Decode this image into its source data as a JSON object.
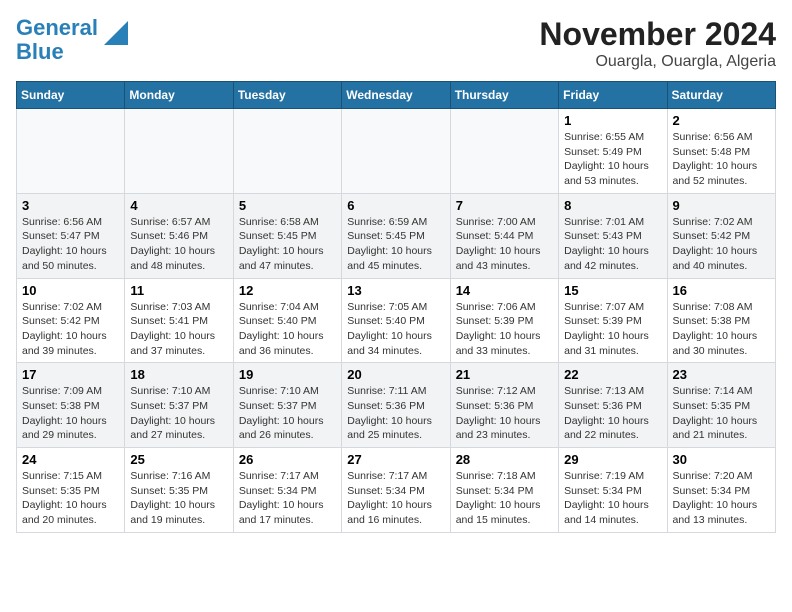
{
  "logo": {
    "line1": "General",
    "line2": "Blue"
  },
  "title": "November 2024",
  "subtitle": "Ouargla, Ouargla, Algeria",
  "weekdays": [
    "Sunday",
    "Monday",
    "Tuesday",
    "Wednesday",
    "Thursday",
    "Friday",
    "Saturday"
  ],
  "weeks": [
    [
      {
        "day": "",
        "detail": ""
      },
      {
        "day": "",
        "detail": ""
      },
      {
        "day": "",
        "detail": ""
      },
      {
        "day": "",
        "detail": ""
      },
      {
        "day": "",
        "detail": ""
      },
      {
        "day": "1",
        "detail": "Sunrise: 6:55 AM\nSunset: 5:49 PM\nDaylight: 10 hours\nand 53 minutes."
      },
      {
        "day": "2",
        "detail": "Sunrise: 6:56 AM\nSunset: 5:48 PM\nDaylight: 10 hours\nand 52 minutes."
      }
    ],
    [
      {
        "day": "3",
        "detail": "Sunrise: 6:56 AM\nSunset: 5:47 PM\nDaylight: 10 hours\nand 50 minutes."
      },
      {
        "day": "4",
        "detail": "Sunrise: 6:57 AM\nSunset: 5:46 PM\nDaylight: 10 hours\nand 48 minutes."
      },
      {
        "day": "5",
        "detail": "Sunrise: 6:58 AM\nSunset: 5:45 PM\nDaylight: 10 hours\nand 47 minutes."
      },
      {
        "day": "6",
        "detail": "Sunrise: 6:59 AM\nSunset: 5:45 PM\nDaylight: 10 hours\nand 45 minutes."
      },
      {
        "day": "7",
        "detail": "Sunrise: 7:00 AM\nSunset: 5:44 PM\nDaylight: 10 hours\nand 43 minutes."
      },
      {
        "day": "8",
        "detail": "Sunrise: 7:01 AM\nSunset: 5:43 PM\nDaylight: 10 hours\nand 42 minutes."
      },
      {
        "day": "9",
        "detail": "Sunrise: 7:02 AM\nSunset: 5:42 PM\nDaylight: 10 hours\nand 40 minutes."
      }
    ],
    [
      {
        "day": "10",
        "detail": "Sunrise: 7:02 AM\nSunset: 5:42 PM\nDaylight: 10 hours\nand 39 minutes."
      },
      {
        "day": "11",
        "detail": "Sunrise: 7:03 AM\nSunset: 5:41 PM\nDaylight: 10 hours\nand 37 minutes."
      },
      {
        "day": "12",
        "detail": "Sunrise: 7:04 AM\nSunset: 5:40 PM\nDaylight: 10 hours\nand 36 minutes."
      },
      {
        "day": "13",
        "detail": "Sunrise: 7:05 AM\nSunset: 5:40 PM\nDaylight: 10 hours\nand 34 minutes."
      },
      {
        "day": "14",
        "detail": "Sunrise: 7:06 AM\nSunset: 5:39 PM\nDaylight: 10 hours\nand 33 minutes."
      },
      {
        "day": "15",
        "detail": "Sunrise: 7:07 AM\nSunset: 5:39 PM\nDaylight: 10 hours\nand 31 minutes."
      },
      {
        "day": "16",
        "detail": "Sunrise: 7:08 AM\nSunset: 5:38 PM\nDaylight: 10 hours\nand 30 minutes."
      }
    ],
    [
      {
        "day": "17",
        "detail": "Sunrise: 7:09 AM\nSunset: 5:38 PM\nDaylight: 10 hours\nand 29 minutes."
      },
      {
        "day": "18",
        "detail": "Sunrise: 7:10 AM\nSunset: 5:37 PM\nDaylight: 10 hours\nand 27 minutes."
      },
      {
        "day": "19",
        "detail": "Sunrise: 7:10 AM\nSunset: 5:37 PM\nDaylight: 10 hours\nand 26 minutes."
      },
      {
        "day": "20",
        "detail": "Sunrise: 7:11 AM\nSunset: 5:36 PM\nDaylight: 10 hours\nand 25 minutes."
      },
      {
        "day": "21",
        "detail": "Sunrise: 7:12 AM\nSunset: 5:36 PM\nDaylight: 10 hours\nand 23 minutes."
      },
      {
        "day": "22",
        "detail": "Sunrise: 7:13 AM\nSunset: 5:36 PM\nDaylight: 10 hours\nand 22 minutes."
      },
      {
        "day": "23",
        "detail": "Sunrise: 7:14 AM\nSunset: 5:35 PM\nDaylight: 10 hours\nand 21 minutes."
      }
    ],
    [
      {
        "day": "24",
        "detail": "Sunrise: 7:15 AM\nSunset: 5:35 PM\nDaylight: 10 hours\nand 20 minutes."
      },
      {
        "day": "25",
        "detail": "Sunrise: 7:16 AM\nSunset: 5:35 PM\nDaylight: 10 hours\nand 19 minutes."
      },
      {
        "day": "26",
        "detail": "Sunrise: 7:17 AM\nSunset: 5:34 PM\nDaylight: 10 hours\nand 17 minutes."
      },
      {
        "day": "27",
        "detail": "Sunrise: 7:17 AM\nSunset: 5:34 PM\nDaylight: 10 hours\nand 16 minutes."
      },
      {
        "day": "28",
        "detail": "Sunrise: 7:18 AM\nSunset: 5:34 PM\nDaylight: 10 hours\nand 15 minutes."
      },
      {
        "day": "29",
        "detail": "Sunrise: 7:19 AM\nSunset: 5:34 PM\nDaylight: 10 hours\nand 14 minutes."
      },
      {
        "day": "30",
        "detail": "Sunrise: 7:20 AM\nSunset: 5:34 PM\nDaylight: 10 hours\nand 13 minutes."
      }
    ]
  ]
}
